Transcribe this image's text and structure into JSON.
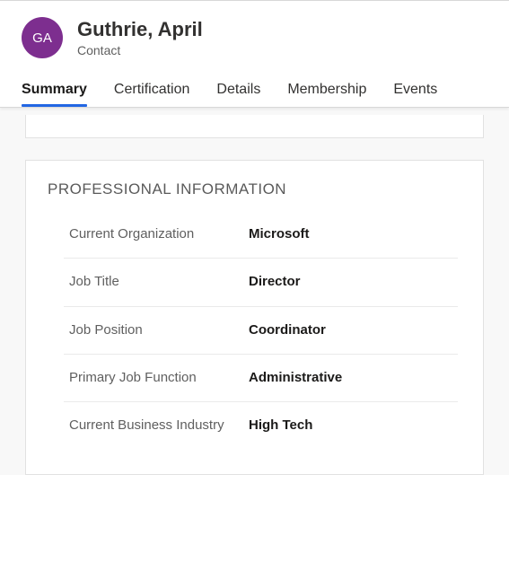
{
  "contact": {
    "initials": "GA",
    "display_name": "Guthrie, April",
    "type_label": "Contact"
  },
  "tabs": [
    {
      "label": "Summary",
      "active": true
    },
    {
      "label": "Certification",
      "active": false
    },
    {
      "label": "Details",
      "active": false
    },
    {
      "label": "Membership",
      "active": false
    },
    {
      "label": "Events",
      "active": false
    }
  ],
  "section": {
    "heading": "PROFESSIONAL INFORMATION",
    "fields": [
      {
        "label": "Current Organization",
        "value": "Microsoft"
      },
      {
        "label": "Job Title",
        "value": "Director"
      },
      {
        "label": "Job Position",
        "value": "Coordinator"
      },
      {
        "label": "Primary Job Function",
        "value": "Administrative"
      },
      {
        "label": "Current Business Industry",
        "value": "High Tech"
      }
    ]
  }
}
